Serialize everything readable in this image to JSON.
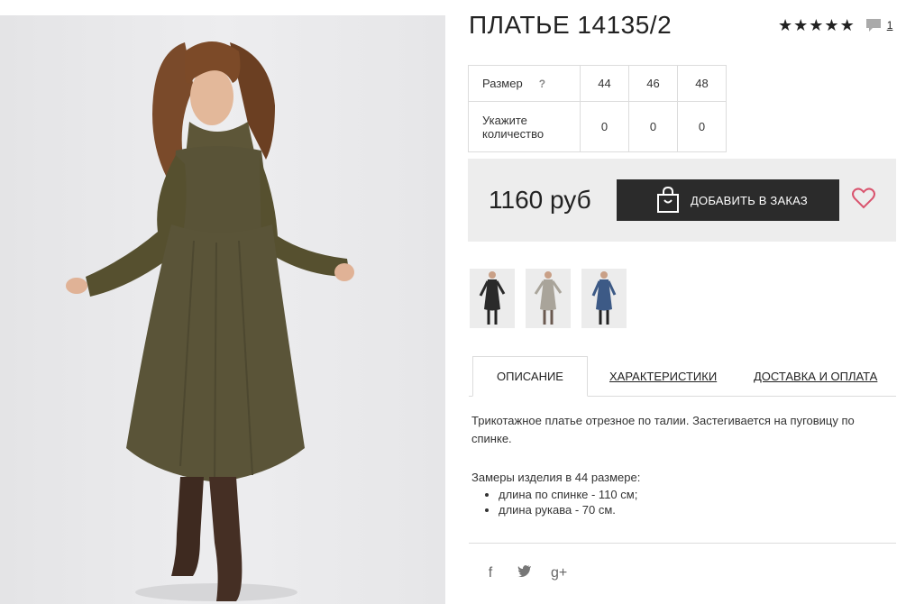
{
  "product": {
    "title": "ПЛАТЬЕ 14135/2",
    "rating_stars": 5,
    "review_count": "1"
  },
  "sizes": {
    "size_label": "Размер",
    "help_mark": "?",
    "size_values": [
      "44",
      "46",
      "48"
    ],
    "qty_label": "Укажите количество",
    "qty_values": [
      "0",
      "0",
      "0"
    ]
  },
  "purchase": {
    "price": "1160 руб",
    "add_button_label": "ДОБАВИТЬ В ЗАКАЗ"
  },
  "thumbnails": [
    "black-dress",
    "grey-dress",
    "blue-dress"
  ],
  "tabs": {
    "description": "ОПИСАНИЕ",
    "characteristics": "ХАРАКТЕРИСТИКИ",
    "delivery": "ДОСТАВКА И ОПЛАТА"
  },
  "description": {
    "text": "Трикотажное платье отрезное по талии. Застегивается на пуговицу по спинке.",
    "measures_title": "Замеры изделия в 44 размере:",
    "measures": [
      "длина по спинке - 110 см;",
      "длина рукава - 70 см."
    ]
  },
  "social": {
    "facebook": "f",
    "twitter": "twitter-icon",
    "googleplus": "g+"
  },
  "colors": {
    "button_bg": "#2b2b2b",
    "heart": "#d9546e",
    "dress_main": "#5a5438"
  }
}
